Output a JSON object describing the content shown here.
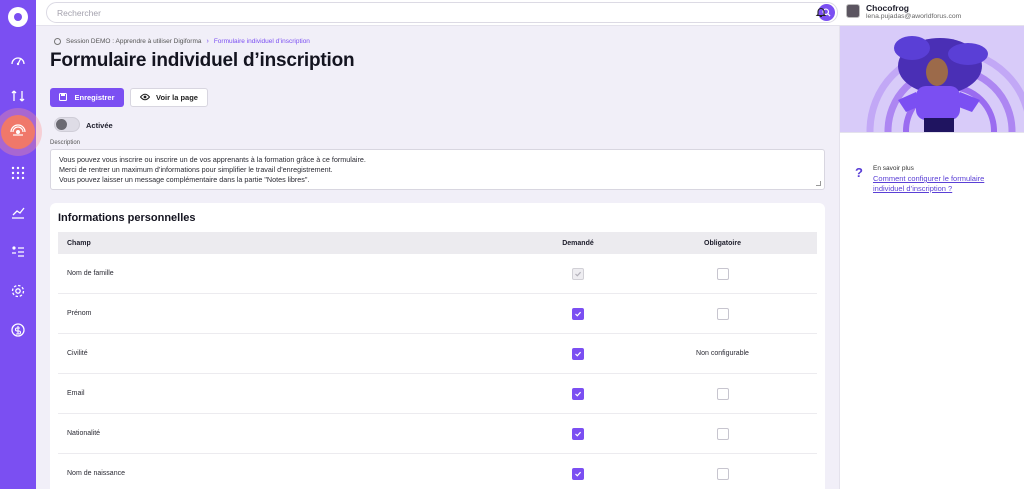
{
  "header": {
    "search_placeholder": "Rechercher",
    "user_name": "Chocofrog",
    "user_email": "lena.pujadas@aworldforus.com"
  },
  "breadcrumb": {
    "parent": "Session DEMO : Apprendre à utiliser Digiforma",
    "current": "Formulaire individuel d’inscription"
  },
  "page": {
    "title": "Formulaire individuel d’inscription",
    "save_label": "Enregistrer",
    "view_label": "Voir la page",
    "toggle_label": "Activée",
    "toggle_on": false,
    "description_label": "Description",
    "description_lines": [
      "Vous pouvez vous inscrire ou inscrire un de vos apprenants à la formation grâce à ce formulaire.",
      "Merci de rentrer un maximum d’informations pour simplifier le travail d’enregistrement.",
      "Vous pouvez laisser un message complémentaire dans la partie \"Notes libres\"."
    ]
  },
  "personal_info": {
    "title": "Informations personnelles",
    "columns": {
      "field": "Champ",
      "requested": "Demandé",
      "mandatory": "Obligatoire"
    },
    "rows": [
      {
        "field": "Nom de famille",
        "requested": "disabled-checked",
        "mandatory": "unchecked",
        "mandatory_text": ""
      },
      {
        "field": "Prénom",
        "requested": "checked",
        "mandatory": "unchecked",
        "mandatory_text": ""
      },
      {
        "field": "Civilité",
        "requested": "checked",
        "mandatory": "text",
        "mandatory_text": "Non configurable"
      },
      {
        "field": "Email",
        "requested": "checked",
        "mandatory": "unchecked",
        "mandatory_text": ""
      },
      {
        "field": "Nationalité",
        "requested": "checked",
        "mandatory": "unchecked",
        "mandatory_text": ""
      },
      {
        "field": "Nom de naissance",
        "requested": "checked",
        "mandatory": "unchecked",
        "mandatory_text": ""
      }
    ]
  },
  "help_panel": {
    "title": "En savoir plus",
    "link": "Comment configurer le formulaire individuel d’inscription ?"
  },
  "colors": {
    "accent": "#7b4ff2",
    "sidebar_active": "#f0786a",
    "link": "#5a3fd6"
  }
}
